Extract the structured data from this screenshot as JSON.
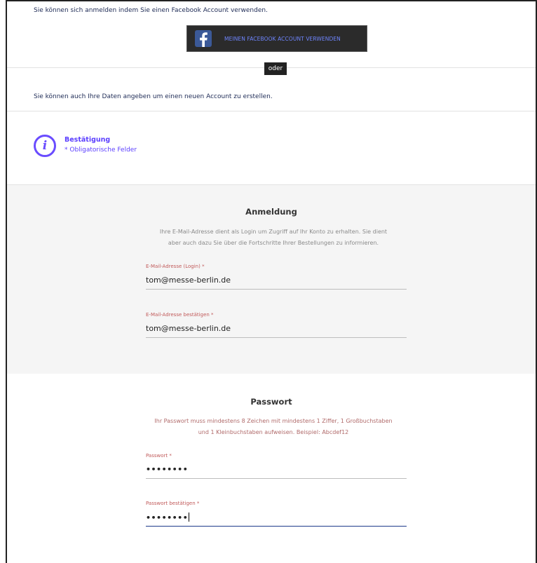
{
  "facebook": {
    "intro_text": "Sie können sich anmelden indem Sie einen Facebook Account verwenden.",
    "button_label": "MEINEN FACEBOOK ACCOUNT VERWENDEN",
    "logo_letter": "f"
  },
  "or_separator": "oder",
  "create_account": {
    "intro_text": "Sie können auch Ihre Daten angeben um einen neuen Account zu erstellen."
  },
  "info": {
    "icon_glyph": "i",
    "title": "Bestätigung",
    "subtitle": "* Obligatorische Felder"
  },
  "login_section": {
    "title": "Anmeldung",
    "description_line1": "Ihre E-Mail-Adresse dient als Login um Zugriff auf Ihr Konto zu erhalten. Sie dient",
    "description_line2": "aber auch dazu Sie über die Fortschritte Ihrer Bestellungen zu informieren.",
    "email": {
      "label": "E-Mail-Adresse (Login) *",
      "value": "tom@messe-berlin.de"
    },
    "email_confirm": {
      "label": "E-Mail-Adresse bestätigen *",
      "value": "tom@messe-berlin.de"
    }
  },
  "password_section": {
    "title": "Passwort",
    "description_line1": "Ihr Passwort muss mindestens 8 Zeichen mit mindestens 1 Ziffer, 1 Großbuchstaben",
    "description_line2": "und 1 Kleinbuchstaben aufweisen. Beispiel: Abcdef12",
    "password": {
      "label": "Passwort *",
      "masked_value": "••••••••"
    },
    "password_confirm": {
      "label": "Passwort bestätigen *",
      "masked_value": "••••••••"
    }
  },
  "colors": {
    "facebook_button_bg": "#2b2b2b",
    "facebook_label": "#6f86ff",
    "accent_purple": "#6a4cff",
    "login_section_bg": "#f5f5f5",
    "required_label": "#c15a5a"
  }
}
